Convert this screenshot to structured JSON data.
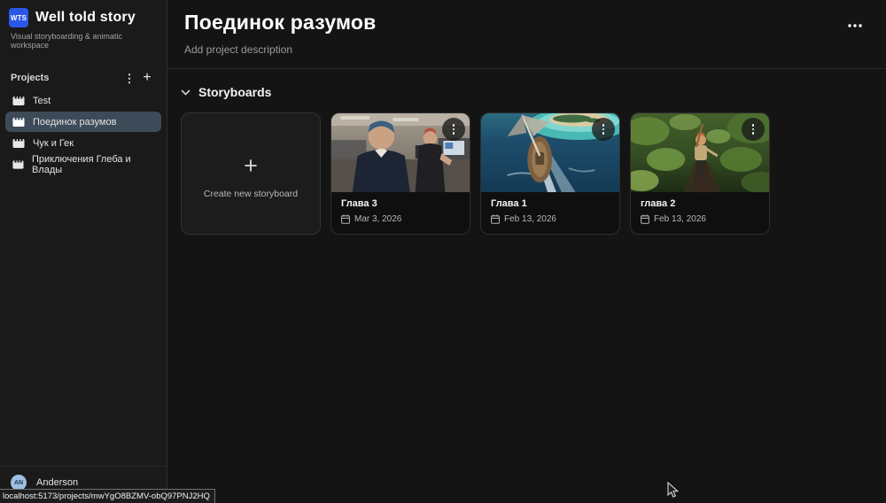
{
  "app": {
    "logo_text": "WTS",
    "title": "Well told story",
    "tagline": "Visual storyboarding & animatic workspace"
  },
  "sidebar": {
    "projects_header": "Projects",
    "kebab_glyph": "⋮",
    "plus_glyph": "+",
    "items": [
      {
        "label": "Test"
      },
      {
        "label": "Поединок разумов"
      },
      {
        "label": "Чук и Гек"
      },
      {
        "label": "Приключения Глеба и Влады"
      }
    ],
    "user": {
      "initials": "AN",
      "name": "Anderson"
    }
  },
  "main": {
    "title": "Поединок разумов",
    "description_placeholder": "Add project description",
    "section_label": "Storyboards",
    "create_card": {
      "plus": "+",
      "label": "Create new storyboard"
    },
    "storyboards": [
      {
        "title": "Глава 3",
        "date": "Mar 3, 2026",
        "thumbnail": "office-scene"
      },
      {
        "title": "Глава 1",
        "date": "Feb 13, 2026",
        "thumbnail": "sailing-ship-scene"
      },
      {
        "title": "глава 2",
        "date": "Feb 13, 2026",
        "thumbnail": "jungle-scene"
      }
    ]
  },
  "statusbar": {
    "url": "localhost:5173/projects/mwYgO8BZMV-obQ97PNJ2HQ"
  },
  "colors": {
    "accent_blue": "#2b57e8",
    "selected_item_bg": "#3d4b59",
    "sidebar_bg": "#1a1a1a",
    "main_bg": "#141414",
    "card_bg": "#0f0f0f",
    "avatar_bg": "#9cc0e0"
  }
}
